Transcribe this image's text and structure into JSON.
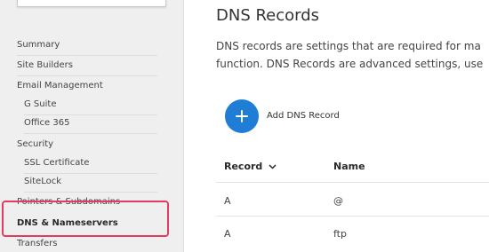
{
  "sidebar": {
    "items": [
      {
        "label": "Summary"
      },
      {
        "label": "Site Builders"
      },
      {
        "label": "Email Management"
      },
      {
        "label": "G Suite"
      },
      {
        "label": "Office 365"
      },
      {
        "label": "Security"
      },
      {
        "label": "SSL Certificate"
      },
      {
        "label": "SiteLock"
      },
      {
        "label": "Pointers & Subdomains"
      },
      {
        "label": "DNS & Nameservers"
      },
      {
        "label": "Transfers"
      }
    ],
    "highlight_color": "#e23c63"
  },
  "main": {
    "title": "DNS Records",
    "description_line1": "DNS records are settings that are required for ma",
    "description_line2": "function. DNS Records are advanced settings, use",
    "add_button": {
      "icon": "plus-icon",
      "label": "Add DNS Record",
      "color": "#1f7dd6"
    },
    "table": {
      "headers": [
        {
          "label": "Record"
        },
        {
          "label": "Name"
        }
      ],
      "sort_icon": "chevron-down-icon",
      "rows": [
        {
          "record": "A",
          "name": "@"
        },
        {
          "record": "A",
          "name": "ftp"
        }
      ]
    }
  }
}
